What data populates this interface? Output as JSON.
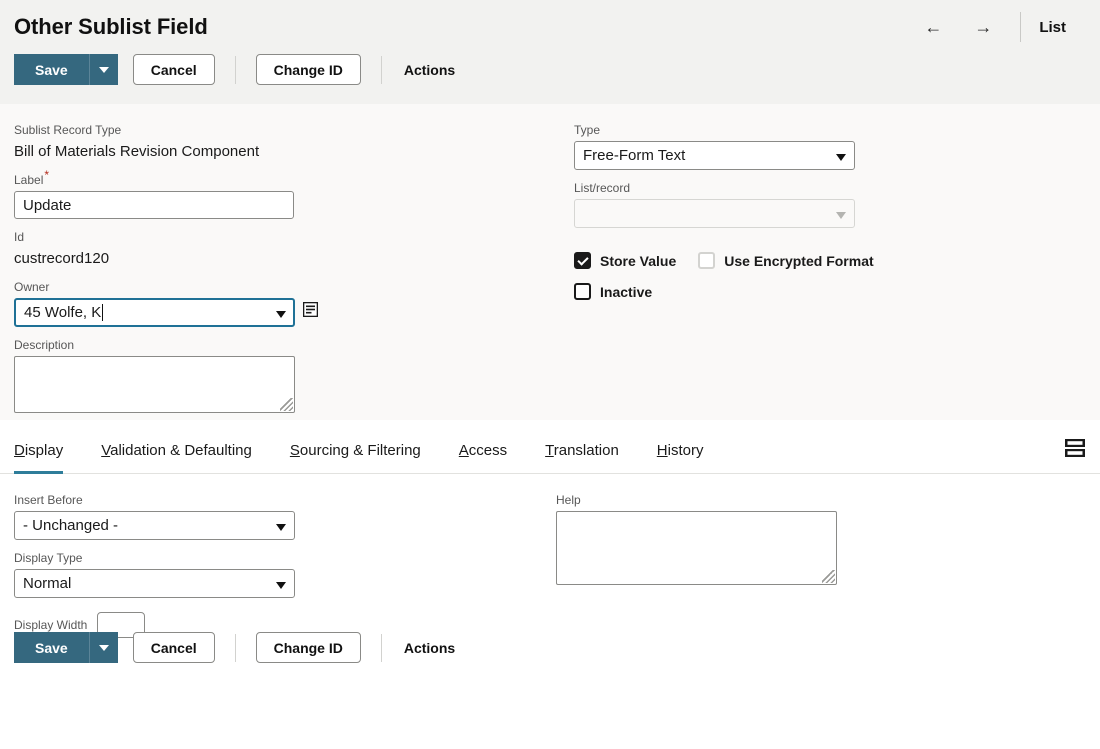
{
  "header": {
    "title": "Other Sublist Field",
    "nav": {
      "back_icon": "arrow-left-icon",
      "back_glyph": "←",
      "forward_icon": "arrow-right-icon",
      "forward_glyph": "→",
      "list_label": "List"
    },
    "toolbar": {
      "save_label": "Save",
      "save_caret_icon": "chevron-down-icon",
      "cancel_label": "Cancel",
      "change_id_label": "Change ID",
      "actions_label": "Actions"
    }
  },
  "form": {
    "sublist_record_type": {
      "label": "Sublist Record Type",
      "value": "Bill of Materials Revision Component"
    },
    "field_label": {
      "label": "Label",
      "required_marker": "*",
      "value": "Update"
    },
    "id": {
      "label": "Id",
      "value": "custrecord120"
    },
    "owner": {
      "label": "Owner",
      "value": "45 Wolfe, K",
      "focused": true,
      "record_icon": "record-list-icon"
    },
    "description": {
      "label": "Description",
      "value": "",
      "placeholder": ""
    },
    "type": {
      "label": "Type",
      "value": "Free-Form Text"
    },
    "list_record": {
      "label": "List/record",
      "value": "",
      "disabled": true
    },
    "store_value": {
      "label": "Store Value",
      "checked": true
    },
    "use_encrypted_format": {
      "label": "Use Encrypted Format",
      "checked": false,
      "disabled": true
    },
    "inactive": {
      "label": "Inactive",
      "checked": false
    }
  },
  "tabs": {
    "items": [
      {
        "label": "Display",
        "accesskey": "D",
        "active": true
      },
      {
        "label": "Validation & Defaulting",
        "accesskey": "V",
        "active": false
      },
      {
        "label": "Sourcing & Filtering",
        "accesskey": "S",
        "active": false
      },
      {
        "label": "Access",
        "accesskey": "A",
        "active": false
      },
      {
        "label": "Translation",
        "accesskey": "T",
        "active": false
      },
      {
        "label": "History",
        "accesskey": "H",
        "active": false
      }
    ],
    "tool_icon": "collapse-rows-icon"
  },
  "display_tab": {
    "insert_before": {
      "label": "Insert Before",
      "value": "- Unchanged -"
    },
    "display_type": {
      "label": "Display Type",
      "value": "Normal"
    },
    "display_width": {
      "label": "Display Width",
      "value": ""
    },
    "help": {
      "label": "Help",
      "value": ""
    }
  },
  "footer": {
    "save_label": "Save",
    "save_caret_icon": "chevron-down-icon",
    "cancel_label": "Cancel",
    "change_id_label": "Change ID",
    "actions_label": "Actions"
  },
  "colors": {
    "primary": "#35687f",
    "accent_tab": "#2e7d9a",
    "focus_ring": "#1f7196",
    "required": "#b32b1b",
    "header_bg": "#f2f2f0",
    "form_bg": "#faf9f8"
  }
}
